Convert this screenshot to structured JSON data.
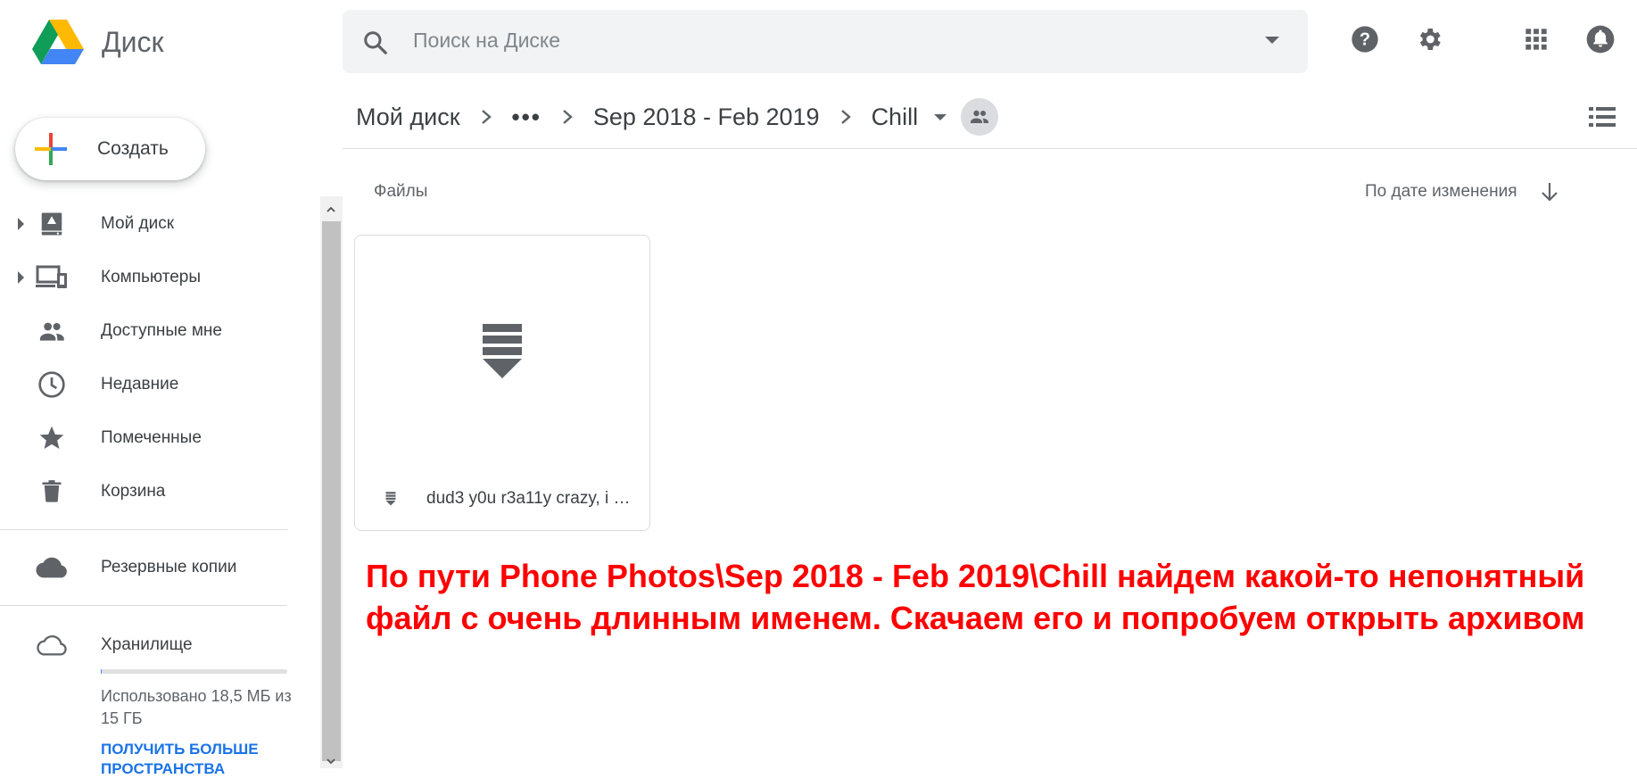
{
  "app": {
    "logo_text": "Диск"
  },
  "search": {
    "placeholder": "Поиск на Диске"
  },
  "header_icons": [
    "help-icon",
    "settings-icon",
    "apps-grid-icon",
    "notifications-icon"
  ],
  "breadcrumb": {
    "root": "Мой диск",
    "more": "•••",
    "parent": "Sep 2018 - Feb 2019",
    "current": "Chill"
  },
  "create_button": {
    "label": "Создать"
  },
  "sidebar": {
    "items": [
      {
        "label": "Мой диск",
        "icon": "my-drive-icon",
        "expandable": true
      },
      {
        "label": "Компьютеры",
        "icon": "computers-icon",
        "expandable": true
      },
      {
        "label": "Доступные мне",
        "icon": "shared-with-me-icon",
        "expandable": false
      },
      {
        "label": "Недавние",
        "icon": "recent-clock-icon",
        "expandable": false
      },
      {
        "label": "Помеченные",
        "icon": "starred-icon",
        "expandable": false
      },
      {
        "label": "Корзина",
        "icon": "trash-icon",
        "expandable": false
      }
    ],
    "backups": {
      "label": "Резервные копии",
      "icon": "cloud-icon"
    },
    "storage": {
      "label": "Хранилище",
      "icon": "cloud-outline-icon",
      "usage_text": "Использовано 18,5 МБ из 15 ГБ",
      "used_fraction": 0.0012,
      "get_more": "ПОЛУЧИТЬ БОЛЬШЕ ПРОСТРАНСТВА"
    }
  },
  "main": {
    "section_title": "Файлы",
    "sort_label": "По дате изменения",
    "files": [
      {
        "name": "dud3 y0u r3a11y crazy, i …",
        "icon": "archive-icon"
      }
    ]
  },
  "annotation": "По пути Phone Photos\\Sep 2018 - Feb 2019\\Chill найдем какой-то непонятный файл с очень длинным именем. Скачаем его и попробуем открыть архивом",
  "colors": {
    "accent_blue": "#1a73e8",
    "annotation_red": "#ff0000",
    "icon_gray": "#5f6368"
  }
}
